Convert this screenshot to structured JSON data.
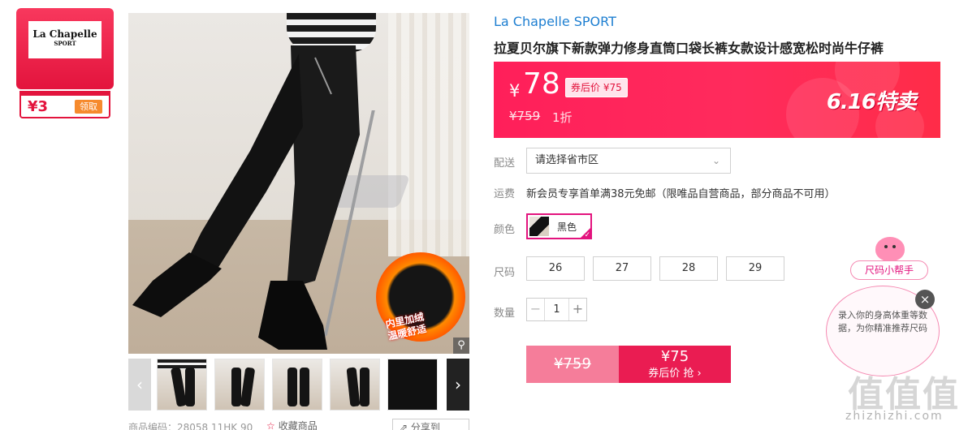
{
  "brand": {
    "logo_name": "La Chapelle",
    "logo_sub": "SPORT",
    "coupon_amount": "¥3",
    "coupon_action": "领取"
  },
  "gallery": {
    "promo_text_line1": "内里加绒",
    "promo_text_line2": "温暖舒适",
    "magnify_icon": "magnify-icon",
    "prev_icon": "‹",
    "next_icon": "›",
    "thumbnail_count": 6
  },
  "footer": {
    "product_code": "商品编码：28058 11HK 90",
    "favorite_label": "收藏商品",
    "share_label": "分享到"
  },
  "product": {
    "brand_title": "La Chapelle SPORT",
    "title": "拉夏贝尔旗下新款弹力修身直筒口袋长裤女款设计感宽松时尚牛仔裤"
  },
  "price": {
    "symbol": "¥",
    "value": "78",
    "coupon_price": "券后价 ¥75",
    "original": "¥759",
    "discount": "1折",
    "event": "6.16特卖"
  },
  "delivery": {
    "label": "配送",
    "placeholder": "请选择省市区"
  },
  "shipping": {
    "label": "运费",
    "text": "新会员专享首单满38元免邮（限唯品自营商品，部分商品不可用）"
  },
  "color": {
    "label": "颜色",
    "selected": "黑色"
  },
  "size": {
    "label": "尺码",
    "options": [
      "26",
      "27",
      "28",
      "29"
    ]
  },
  "quantity": {
    "label": "数量",
    "value": "1",
    "minus": "−",
    "plus": "+"
  },
  "buy": {
    "original": "¥759",
    "price": "¥75",
    "action": "券后价 抢 ›"
  },
  "helper": {
    "tag": "尺码小帮手",
    "text": "录入你的身高体重等数据，为你精准推荐尺码",
    "close": "×"
  },
  "watermark": {
    "main": "值值值",
    "url": "zhizhizhi.com"
  },
  "colors": {
    "accent": "#e3143d",
    "banner": "#ff2b5c",
    "link": "#1e7fd1",
    "selected_border": "#e3147e"
  }
}
